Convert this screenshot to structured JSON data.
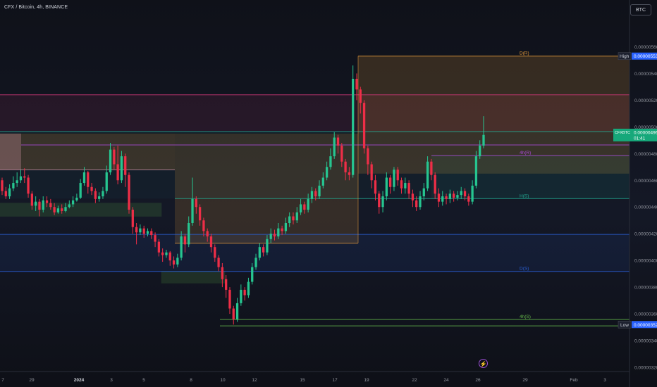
{
  "header": {
    "title": "CFX / Bitcoin, 4h, BINANCE",
    "currency": "BTC"
  },
  "chart_data": {
    "type": "candlestick",
    "symbol": "CFX/BTC",
    "interval": "4h",
    "exchange": "BINANCE",
    "x_ticks": [
      "7",
      "29",
      "2024",
      "3",
      "5",
      "8",
      "10",
      "12",
      "15",
      "17",
      "19",
      "22",
      "24",
      "26",
      "29",
      "Feb",
      "3"
    ],
    "y_ticks": [
      "0.00000580",
      "0.00000560",
      "0.00000540",
      "0.00000520",
      "0.00000500",
      "0.00000480",
      "0.00000460",
      "0.00000440",
      "0.00000420",
      "0.00000400",
      "0.00000380",
      "0.00000360",
      "0.00000340",
      "0.00000320"
    ],
    "ylim": [
      3.2e-06,
      5.95e-06
    ],
    "price_labels": {
      "high_tag": "High",
      "high_value": "0.00000553",
      "current_symbol": "CFXBTC",
      "current_value": "0.00000496",
      "countdown": "01:41",
      "low_tag": "Low",
      "low_value": "0.00000352"
    },
    "levels": [
      {
        "name": "D(R)",
        "value": 5.53e-06,
        "color": "#e69b3a"
      },
      {
        "name": "",
        "value": 5.24e-06,
        "color": "#d4367a"
      },
      {
        "name": "",
        "value": 4.965e-06,
        "color": "#22ab94"
      },
      {
        "name": "",
        "value": 4.865e-06,
        "color": "#a84ad6"
      },
      {
        "name": "4h(R)",
        "value": 4.785e-06,
        "color": "#a84ad6"
      },
      {
        "name": "H(S)",
        "value": 4.463e-06,
        "color": "#22ab94"
      },
      {
        "name": "",
        "value": 4.195e-06,
        "color": "#2a5fd6"
      },
      {
        "name": "D(S)",
        "value": 3.918e-06,
        "color": "#2a5fd6"
      },
      {
        "name": "4h(S)",
        "value": 3.558e-06,
        "color": "#63b84a"
      }
    ],
    "candles": [
      [
        4.6,
        4.52,
        4.62,
        4.49
      ],
      [
        4.52,
        4.48,
        4.55,
        4.46
      ],
      [
        4.48,
        4.54,
        4.57,
        4.46
      ],
      [
        4.54,
        4.58,
        4.63,
        4.52
      ],
      [
        4.58,
        4.6,
        4.66,
        4.55
      ],
      [
        4.6,
        4.63,
        4.68,
        4.58
      ],
      [
        4.63,
        4.62,
        4.69,
        4.58
      ],
      [
        4.62,
        4.5,
        4.64,
        4.47
      ],
      [
        4.5,
        4.41,
        4.52,
        4.38
      ],
      [
        4.41,
        4.44,
        4.48,
        4.37
      ],
      [
        4.44,
        4.38,
        4.46,
        4.33
      ],
      [
        4.38,
        4.45,
        4.48,
        4.36
      ],
      [
        4.45,
        4.43,
        4.48,
        4.4
      ],
      [
        4.43,
        4.4,
        4.46,
        4.38
      ],
      [
        4.4,
        4.36,
        4.43,
        4.34
      ],
      [
        4.36,
        4.39,
        4.41,
        4.35
      ],
      [
        4.39,
        4.37,
        4.42,
        4.35
      ],
      [
        4.37,
        4.4,
        4.43,
        4.36
      ],
      [
        4.4,
        4.42,
        4.45,
        4.39
      ],
      [
        4.42,
        4.45,
        4.48,
        4.4
      ],
      [
        4.45,
        4.47,
        4.5,
        4.44
      ],
      [
        4.47,
        4.58,
        4.61,
        4.46
      ],
      [
        4.58,
        4.66,
        4.7,
        4.56
      ],
      [
        4.66,
        4.55,
        4.67,
        4.5
      ],
      [
        4.55,
        4.52,
        4.58,
        4.49
      ],
      [
        4.52,
        4.46,
        4.54,
        4.43
      ],
      [
        4.46,
        4.48,
        4.51,
        4.44
      ],
      [
        4.48,
        4.52,
        4.55,
        4.46
      ],
      [
        4.52,
        4.66,
        4.71,
        4.5
      ],
      [
        4.66,
        4.83,
        4.88,
        4.64
      ],
      [
        4.83,
        4.72,
        4.85,
        4.68
      ],
      [
        4.72,
        4.6,
        4.86,
        4.57
      ],
      [
        4.6,
        4.78,
        4.82,
        4.58
      ],
      [
        4.78,
        4.64,
        4.8,
        4.55
      ],
      [
        4.64,
        4.38,
        4.66,
        4.35
      ],
      [
        4.38,
        4.25,
        4.4,
        4.2
      ],
      [
        4.25,
        4.21,
        4.28,
        4.12
      ],
      [
        4.21,
        4.24,
        4.27,
        4.19
      ],
      [
        4.24,
        4.2,
        4.26,
        4.17
      ],
      [
        4.2,
        4.22,
        4.24,
        4.18
      ],
      [
        4.22,
        4.19,
        4.24,
        4.16
      ],
      [
        4.19,
        4.14,
        4.21,
        4.1
      ],
      [
        4.14,
        4.06,
        4.16,
        4.03
      ],
      [
        4.06,
        4.04,
        4.09,
        3.99
      ],
      [
        4.04,
        4.06,
        4.08,
        4.02
      ],
      [
        4.06,
        4.0,
        4.07,
        3.96
      ],
      [
        4.0,
        3.97,
        4.03,
        3.94
      ],
      [
        3.97,
        4.02,
        4.05,
        3.95
      ],
      [
        4.02,
        4.18,
        4.22,
        4.0
      ],
      [
        4.18,
        4.12,
        4.2,
        4.06
      ],
      [
        4.12,
        4.28,
        4.33,
        4.1
      ],
      [
        4.28,
        4.46,
        4.62,
        4.26
      ],
      [
        4.46,
        4.4,
        4.48,
        4.35
      ],
      [
        4.4,
        4.3,
        4.42,
        4.26
      ],
      [
        4.3,
        4.22,
        4.32,
        4.18
      ],
      [
        4.22,
        4.18,
        4.24,
        4.14
      ],
      [
        4.18,
        4.1,
        4.2,
        4.06
      ],
      [
        4.1,
        4.02,
        4.12,
        3.99
      ],
      [
        4.02,
        3.95,
        4.04,
        3.92
      ],
      [
        3.95,
        3.86,
        3.98,
        3.8
      ],
      [
        3.86,
        3.78,
        3.89,
        3.72
      ],
      [
        3.78,
        3.64,
        3.8,
        3.6
      ],
      [
        3.64,
        3.56,
        3.66,
        3.52
      ],
      [
        3.56,
        3.68,
        3.72,
        3.54
      ],
      [
        3.68,
        3.78,
        3.82,
        3.66
      ],
      [
        3.78,
        3.74,
        3.8,
        3.7
      ],
      [
        3.74,
        3.84,
        3.87,
        3.72
      ],
      [
        3.84,
        3.95,
        3.98,
        3.82
      ],
      [
        3.95,
        4.02,
        4.05,
        3.93
      ],
      [
        4.02,
        4.1,
        4.13,
        4.0
      ],
      [
        4.1,
        4.06,
        4.12,
        4.03
      ],
      [
        4.06,
        4.16,
        4.19,
        4.04
      ],
      [
        4.16,
        4.2,
        4.24,
        4.13
      ],
      [
        4.2,
        4.18,
        4.23,
        4.15
      ],
      [
        4.18,
        4.24,
        4.28,
        4.16
      ],
      [
        4.24,
        4.22,
        4.26,
        4.19
      ],
      [
        4.22,
        4.28,
        4.32,
        4.2
      ],
      [
        4.28,
        4.33,
        4.36,
        4.25
      ],
      [
        4.33,
        4.3,
        4.36,
        4.27
      ],
      [
        4.3,
        4.36,
        4.4,
        4.28
      ],
      [
        4.36,
        4.42,
        4.46,
        4.34
      ],
      [
        4.42,
        4.38,
        4.44,
        4.35
      ],
      [
        4.38,
        4.46,
        4.5,
        4.36
      ],
      [
        4.46,
        4.52,
        4.55,
        4.43
      ],
      [
        4.52,
        4.48,
        4.54,
        4.45
      ],
      [
        4.48,
        4.56,
        4.6,
        4.46
      ],
      [
        4.56,
        4.62,
        4.66,
        4.54
      ],
      [
        4.62,
        4.7,
        4.74,
        4.6
      ],
      [
        4.7,
        4.78,
        4.84,
        4.68
      ],
      [
        4.78,
        4.92,
        4.96,
        4.76
      ],
      [
        4.92,
        4.86,
        4.94,
        4.8
      ],
      [
        4.86,
        4.74,
        4.88,
        4.7
      ],
      [
        4.74,
        4.66,
        4.76,
        4.6
      ],
      [
        4.66,
        4.64,
        4.7,
        4.6
      ],
      [
        4.64,
        5.36,
        5.46,
        4.62
      ],
      [
        5.36,
        5.28,
        5.4,
        5.2
      ],
      [
        5.28,
        5.18,
        5.3,
        5.1
      ],
      [
        5.18,
        4.84,
        5.2,
        4.8
      ],
      [
        4.84,
        4.72,
        4.86,
        4.64
      ],
      [
        4.72,
        4.6,
        4.74,
        4.54
      ],
      [
        4.6,
        4.5,
        4.64,
        4.45
      ],
      [
        4.5,
        4.4,
        4.52,
        4.35
      ],
      [
        4.4,
        4.48,
        4.52,
        4.36
      ],
      [
        4.48,
        4.62,
        4.66,
        4.45
      ],
      [
        4.62,
        4.55,
        4.64,
        4.5
      ],
      [
        4.55,
        4.68,
        4.7,
        4.52
      ],
      [
        4.68,
        4.6,
        4.7,
        4.56
      ],
      [
        4.6,
        4.54,
        4.62,
        4.5
      ],
      [
        4.54,
        4.58,
        4.62,
        4.5
      ],
      [
        4.58,
        4.5,
        4.6,
        4.46
      ],
      [
        4.5,
        4.45,
        4.53,
        4.4
      ],
      [
        4.45,
        4.4,
        4.48,
        4.37
      ],
      [
        4.4,
        4.48,
        4.52,
        4.38
      ],
      [
        4.48,
        4.54,
        4.58,
        4.45
      ],
      [
        4.54,
        4.74,
        4.78,
        4.52
      ],
      [
        4.74,
        4.64,
        4.76,
        4.6
      ],
      [
        4.64,
        4.5,
        4.66,
        4.46
      ],
      [
        4.5,
        4.44,
        4.54,
        4.4
      ],
      [
        4.44,
        4.48,
        4.52,
        4.41
      ],
      [
        4.48,
        4.46,
        4.5,
        4.42
      ],
      [
        4.46,
        4.5,
        4.53,
        4.43
      ],
      [
        4.5,
        4.47,
        4.52,
        4.44
      ],
      [
        4.47,
        4.49,
        4.52,
        4.45
      ],
      [
        4.49,
        4.52,
        4.55,
        4.46
      ],
      [
        4.52,
        4.48,
        4.54,
        4.45
      ],
      [
        4.48,
        4.44,
        4.5,
        4.41
      ],
      [
        4.44,
        4.56,
        4.6,
        4.42
      ],
      [
        4.56,
        4.78,
        4.82,
        4.54
      ],
      [
        4.78,
        4.86,
        4.9,
        4.76
      ],
      [
        4.86,
        4.94,
        5.08,
        4.84
      ]
    ]
  }
}
